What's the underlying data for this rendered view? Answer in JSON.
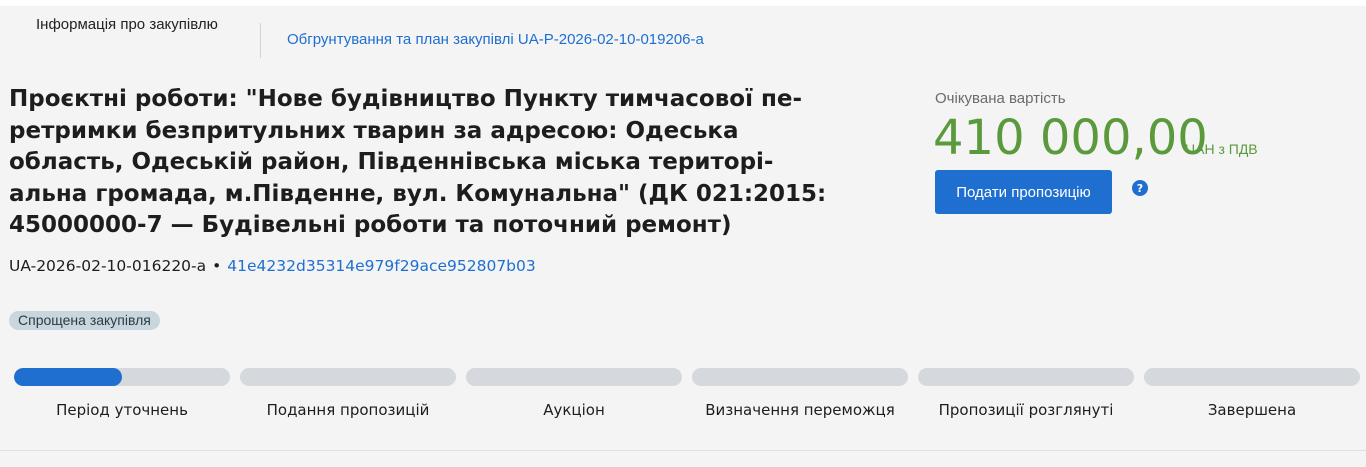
{
  "tabs": {
    "info_label": "Інформація про закупівлю",
    "plan_link": "Обгрунтування та план закупівлі UA-P-2026-02-10-019206-a"
  },
  "tender": {
    "title": "Проєктні роботи: \"Нове будівництво Пункту тимчасової пе-ретримки безпритульних тварин за адресою: Одеська область, Одеській район, Південнівська міська територі-альна громада, м.Південне, вул. Комунальна\" (ДК 021:2015: 45000000-7 — Будівельні роботи та поточний ремонт)",
    "id": "UA-2026-02-10-016220-a",
    "separator": "•",
    "hash": "41e4232d35314e979f29ace952807b03",
    "procedure_badge": "Спрощена закупівля"
  },
  "price": {
    "label": "Очікувана вартість",
    "value": "410 000,00",
    "unit": "UAH з ПДВ"
  },
  "actions": {
    "submit_label": "Подати пропозицію",
    "help_icon": "question-circle-icon"
  },
  "stages": [
    {
      "label": "Період уточнень",
      "progress": 0.5
    },
    {
      "label": "Подання пропозицій",
      "progress": 0
    },
    {
      "label": "Аукціон",
      "progress": 0
    },
    {
      "label": "Визначення переможця",
      "progress": 0
    },
    {
      "label": "Пропозиції розглянуті",
      "progress": 0
    },
    {
      "label": "Завершена",
      "progress": 0
    }
  ],
  "colors": {
    "accent": "#1f6fd0",
    "price": "#5a9a3c",
    "bar_inactive": "#d5d8dc",
    "badge_bg": "#c9d6de"
  }
}
